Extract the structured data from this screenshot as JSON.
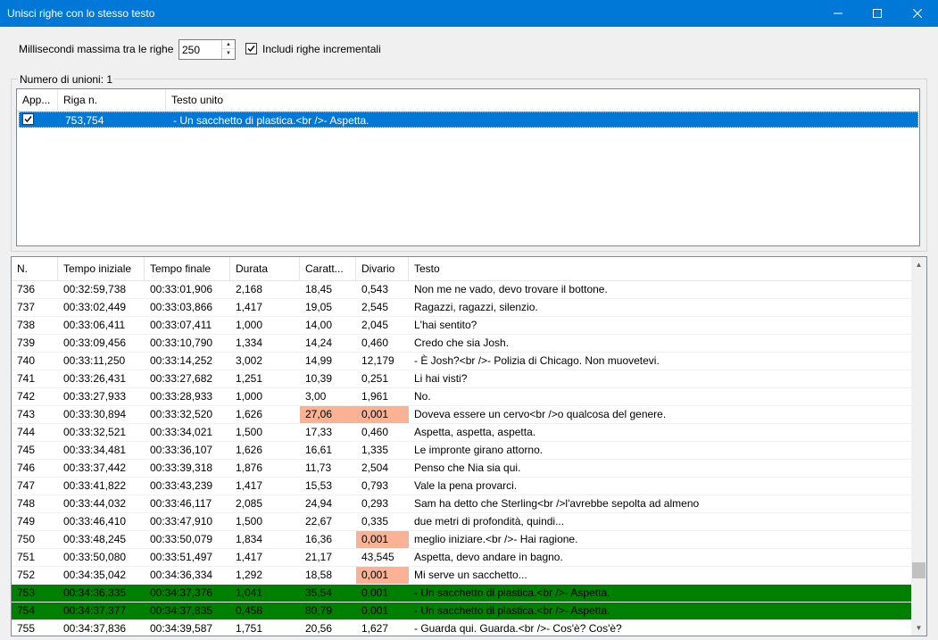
{
  "window": {
    "title": "Unisci righe con lo stesso testo",
    "controls": [
      "minimize-icon",
      "maximize-icon",
      "close-icon"
    ]
  },
  "options": {
    "max_ms_label": "Millisecondi massima tra le righe",
    "max_ms_value": "250",
    "include_incremental_label": "Includi righe incrementali",
    "include_incremental_checked": true
  },
  "merges": {
    "count_label": "Numero di unioni: 1",
    "columns": [
      "App...",
      "Riga n.",
      "Testo unito"
    ],
    "rows": [
      {
        "apply": true,
        "line_numbers": "753,754",
        "merged_text": "- Un sacchetto di plastica.<br />- Aspetta."
      }
    ]
  },
  "subtitles": {
    "columns": [
      "N.",
      "Tempo iniziale",
      "Tempo finale",
      "Durata",
      "Caratt...",
      "Divario",
      "Testo"
    ],
    "highlight_color": "#f9b293",
    "selected_color": "#008000",
    "rows": [
      {
        "n": "736",
        "start": "00:32:59,738",
        "end": "00:33:01,906",
        "dur": "2,168",
        "cps": "18,45",
        "gap": "0,543",
        "text": "Non me ne vado, devo trovare il bottone."
      },
      {
        "n": "737",
        "start": "00:33:02,449",
        "end": "00:33:03,866",
        "dur": "1,417",
        "cps": "19,05",
        "gap": "2,545",
        "text": "Ragazzi, ragazzi, silenzio."
      },
      {
        "n": "738",
        "start": "00:33:06,411",
        "end": "00:33:07,411",
        "dur": "1,000",
        "cps": "14,00",
        "gap": "2,045",
        "text": "L'hai sentito?"
      },
      {
        "n": "739",
        "start": "00:33:09,456",
        "end": "00:33:10,790",
        "dur": "1,334",
        "cps": "14,24",
        "gap": "0,460",
        "text": "Credo che sia Josh."
      },
      {
        "n": "740",
        "start": "00:33:11,250",
        "end": "00:33:14,252",
        "dur": "3,002",
        "cps": "14,99",
        "gap": "12,179",
        "text": "- È Josh?<br />- Polizia di Chicago. Non muovetevi."
      },
      {
        "n": "741",
        "start": "00:33:26,431",
        "end": "00:33:27,682",
        "dur": "1,251",
        "cps": "10,39",
        "gap": "0,251",
        "text": "Li hai visti?"
      },
      {
        "n": "742",
        "start": "00:33:27,933",
        "end": "00:33:28,933",
        "dur": "1,000",
        "cps": "3,00",
        "gap": "1,961",
        "text": "No."
      },
      {
        "n": "743",
        "start": "00:33:30,894",
        "end": "00:33:32,520",
        "dur": "1,626",
        "cps": "27,06",
        "gap": "0,001",
        "text": "Doveva essere un cervo<br />o qualcosa del genere.",
        "hl_cps": true,
        "hl_gap": true
      },
      {
        "n": "744",
        "start": "00:33:32,521",
        "end": "00:33:34,021",
        "dur": "1,500",
        "cps": "17,33",
        "gap": "0,460",
        "text": "Aspetta, aspetta, aspetta."
      },
      {
        "n": "745",
        "start": "00:33:34,481",
        "end": "00:33:36,107",
        "dur": "1,626",
        "cps": "16,61",
        "gap": "1,335",
        "text": "Le impronte girano attorno."
      },
      {
        "n": "746",
        "start": "00:33:37,442",
        "end": "00:33:39,318",
        "dur": "1,876",
        "cps": "11,73",
        "gap": "2,504",
        "text": "Penso che Nia sia qui."
      },
      {
        "n": "747",
        "start": "00:33:41,822",
        "end": "00:33:43,239",
        "dur": "1,417",
        "cps": "15,53",
        "gap": "0,793",
        "text": "Vale la pena provarci."
      },
      {
        "n": "748",
        "start": "00:33:44,032",
        "end": "00:33:46,117",
        "dur": "2,085",
        "cps": "24,94",
        "gap": "0,293",
        "text": "Sam ha detto che Sterling<br />l'avrebbe sepolta ad almeno"
      },
      {
        "n": "749",
        "start": "00:33:46,410",
        "end": "00:33:47,910",
        "dur": "1,500",
        "cps": "22,67",
        "gap": "0,335",
        "text": "due metri di profondità, quindi..."
      },
      {
        "n": "750",
        "start": "00:33:48,245",
        "end": "00:33:50,079",
        "dur": "1,834",
        "cps": "16,36",
        "gap": "0,001",
        "text": "meglio iniziare.<br />- Hai ragione.",
        "hl_gap": true
      },
      {
        "n": "751",
        "start": "00:33:50,080",
        "end": "00:33:51,497",
        "dur": "1,417",
        "cps": "21,17",
        "gap": "43,545",
        "text": "Aspetta, devo andare in bagno."
      },
      {
        "n": "752",
        "start": "00:34:35,042",
        "end": "00:34:36,334",
        "dur": "1,292",
        "cps": "18,58",
        "gap": "0,001",
        "text": "Mi serve un sacchetto...",
        "hl_gap": true
      },
      {
        "n": "753",
        "start": "00:34:36,335",
        "end": "00:34:37,376",
        "dur": "1,041",
        "cps": "35,54",
        "gap": "0,001",
        "text": "- Un sacchetto di plastica.<br />- Aspetta.",
        "selected": true
      },
      {
        "n": "754",
        "start": "00:34:37,377",
        "end": "00:34:37,835",
        "dur": "0,458",
        "cps": "80,79",
        "gap": "0,001",
        "text": "- Un sacchetto di plastica.<br />- Aspetta.",
        "selected": true
      },
      {
        "n": "755",
        "start": "00:34:37,836",
        "end": "00:34:39,587",
        "dur": "1,751",
        "cps": "20,56",
        "gap": "1,627",
        "text": "- Guarda qui. Guarda.<br />- Cos'è? Cos'è?"
      }
    ]
  }
}
